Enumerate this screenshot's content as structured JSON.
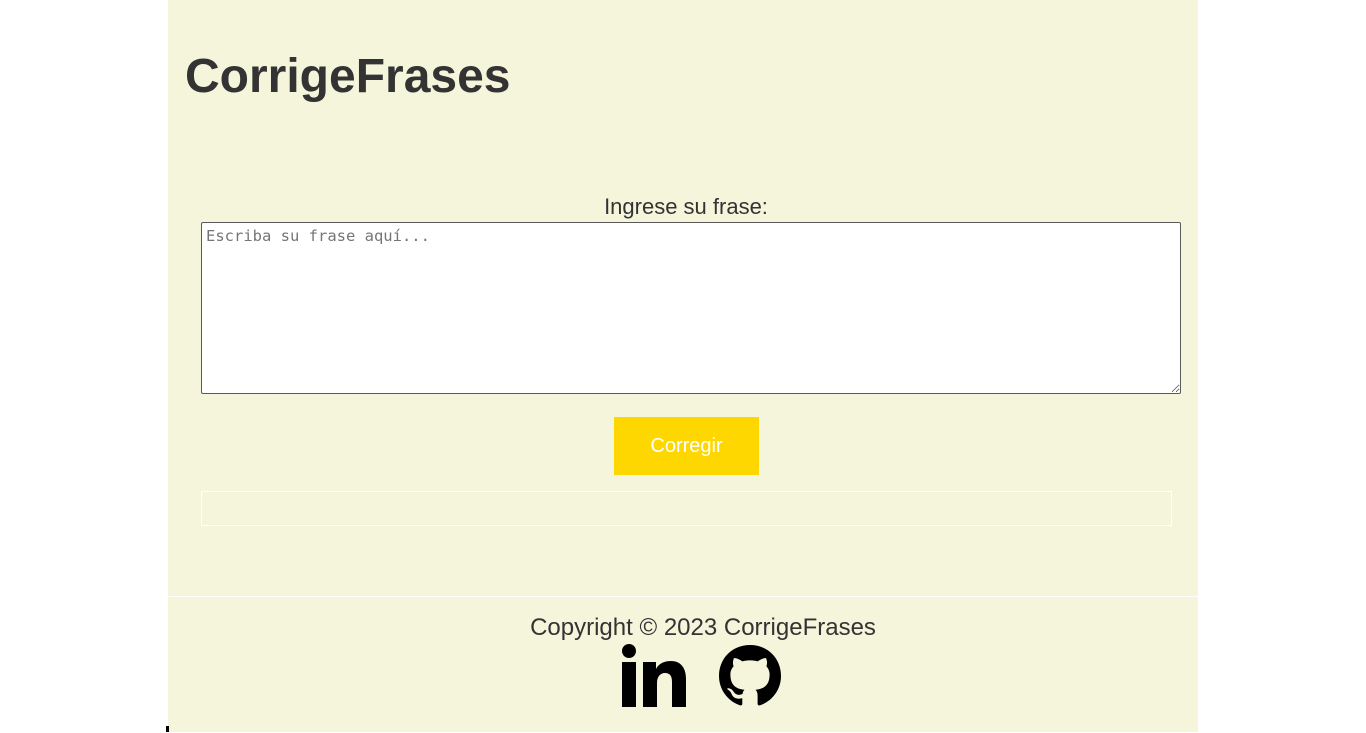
{
  "header": {
    "title": "CorrigeFrases"
  },
  "form": {
    "label": "Ingrese su frase:",
    "textarea_placeholder": "Escriba su frase aquí...",
    "textarea_value": "",
    "submit_label": "Corregir",
    "result_text": ""
  },
  "footer": {
    "copyright": "Copyright © 2023 CorrigeFrases",
    "social": [
      {
        "icon": "linkedin-icon"
      },
      {
        "icon": "github-icon"
      }
    ]
  },
  "colors": {
    "page_background": "#f5f5dc",
    "button_background": "#ffd700",
    "button_text": "#ffffff",
    "text": "#333333"
  }
}
